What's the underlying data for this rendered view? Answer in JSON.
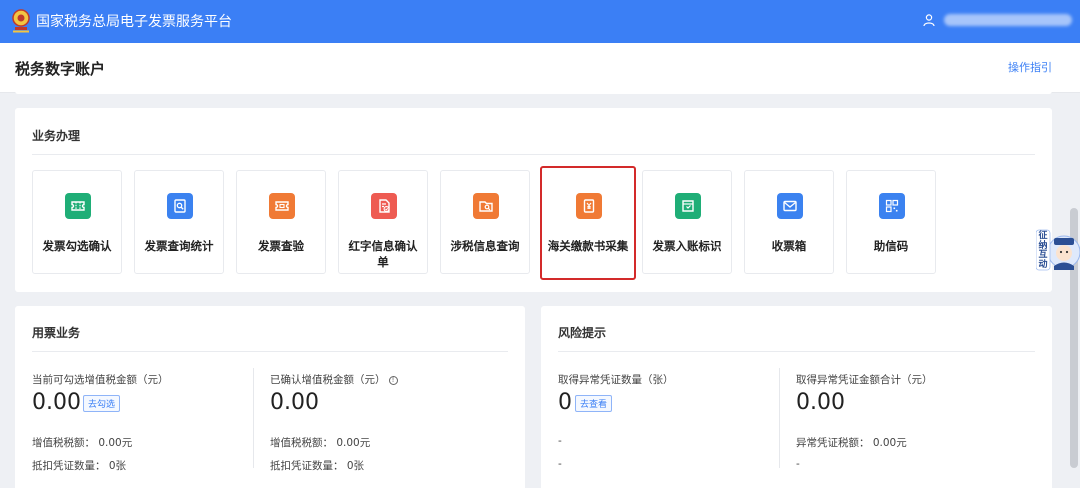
{
  "header": {
    "title": "国家税务总局电子发票服务平台"
  },
  "subheader": {
    "title": "税务数字账户",
    "guide_link": "操作指引"
  },
  "business": {
    "title": "业务办理",
    "tiles": [
      {
        "label": "发票勾选确认",
        "icon": "ticket-icon",
        "color": "#1fae77"
      },
      {
        "label": "发票查询统计",
        "icon": "document-search-icon",
        "color": "#3b82f0"
      },
      {
        "label": "发票查验",
        "icon": "ticket-check-icon",
        "color": "#f07a35"
      },
      {
        "label": "红字信息确认单",
        "icon": "document-check-icon",
        "color": "#ee5b52"
      },
      {
        "label": "涉税信息查询",
        "icon": "folder-search-icon",
        "color": "#f07a35"
      },
      {
        "label": "海关缴款书采集",
        "icon": "document-yen-icon",
        "color": "#f07a35",
        "highlighted": true
      },
      {
        "label": "发票入账标识",
        "icon": "ticket-mark-icon",
        "color": "#1fae77"
      },
      {
        "label": "收票箱",
        "icon": "mail-icon",
        "color": "#3b82f0"
      },
      {
        "label": "助信码",
        "icon": "qr-code-icon",
        "color": "#3b82f0"
      }
    ]
  },
  "usage": {
    "title": "用票业务",
    "left": {
      "label": "当前可勾选增值税金额（元）",
      "value": "0.00",
      "action": "去勾选",
      "line1": "增值税税额： 0.00元",
      "line2": "抵扣凭证数量： 0张"
    },
    "right": {
      "label": "已确认增值税金额（元）",
      "info": "!",
      "value": "0.00",
      "line1": "增值税税额： 0.00元",
      "line2": "抵扣凭证数量： 0张"
    }
  },
  "risk": {
    "title": "风险提示",
    "left": {
      "label": "取得异常凭证数量（张）",
      "value": "0",
      "action": "去查看",
      "line1": "-",
      "line2": "-"
    },
    "right": {
      "label": "取得异常凭证金额合计（元）",
      "value": "0.00",
      "line1": "异常凭证税额： 0.00元",
      "line2": "-"
    }
  },
  "assistant": {
    "text": "征纳互动"
  }
}
